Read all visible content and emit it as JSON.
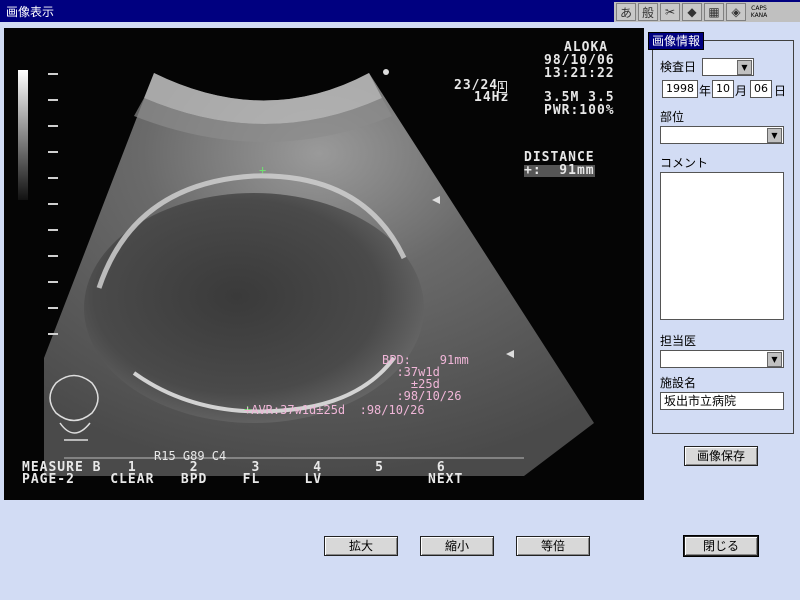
{
  "window": {
    "title": "画像表示"
  },
  "ime_bar": {
    "kana": "あ",
    "mode": "般",
    "caps": "CAPS",
    "kana_label": "KANA"
  },
  "ultrasound": {
    "brand": "ALOKA",
    "date": "98/10/06",
    "time": "13:21:22",
    "frame": "23/24",
    "frame_mark": "1",
    "rate": "14Hz",
    "probe": "3.5M 3.5",
    "power": "PWR:100%",
    "distance_title": "DISTANCE",
    "distance_value": "+:  91mm",
    "bpd_line1": "BPD:    91mm",
    "bpd_line2": "  :37w1d",
    "bpd_line3": "    ±25d",
    "bpd_line4": "  :98/10/26",
    "avr_line": "+AVR:37w1d±25d  :98/10/26",
    "gain": "R15 G89 C4",
    "measure_row": "MEASURE B   1      2      3      4      5      6",
    "page_row": "PAGE-2    CLEAR   BPD    FL     LV            NEXT"
  },
  "info_panel": {
    "tab": "画像情報",
    "exam_date_label": "検査日",
    "year": "1998",
    "year_unit": "年",
    "month": "10",
    "month_unit": "月",
    "day": "06",
    "day_unit": "日",
    "site_label": "部位",
    "comment_label": "コメント",
    "doctor_label": "担当医",
    "facility_label": "施設名",
    "facility_value": "坂出市立病院"
  },
  "buttons": {
    "save": "画像保存",
    "zoom_in": "拡大",
    "zoom_out": "縮小",
    "actual": "等倍",
    "close": "閉じる"
  }
}
